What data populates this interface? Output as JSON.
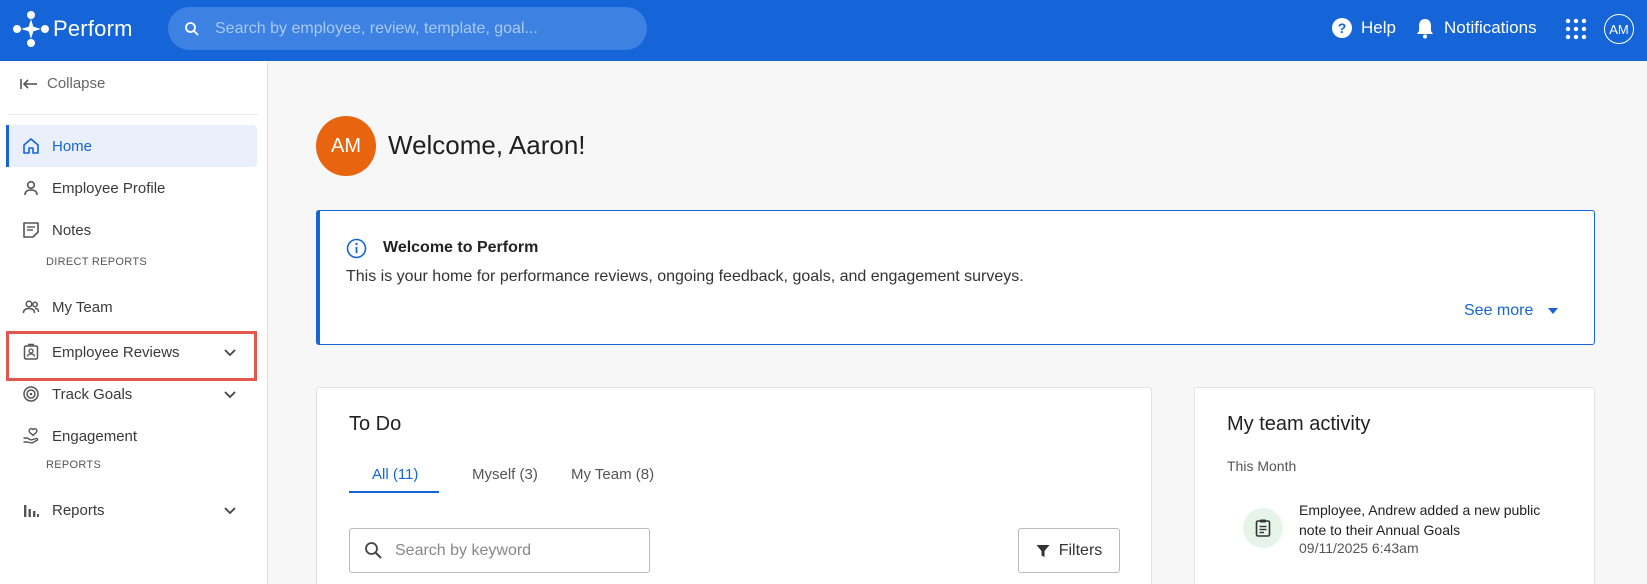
{
  "header": {
    "app_name": "Perform",
    "search_placeholder": "Search by employee, review, template, goal...",
    "help_label": "Help",
    "notifications_label": "Notifications",
    "user_initials": "AM",
    "brand_color": "#1565d8"
  },
  "sidebar": {
    "collapse_label": "Collapse",
    "items": [
      {
        "label": "Home",
        "icon": "home-icon",
        "active": true
      },
      {
        "label": "Employee Profile",
        "icon": "person-icon"
      },
      {
        "label": "Notes",
        "icon": "note-icon"
      },
      {
        "label": "My Team",
        "icon": "team-icon"
      },
      {
        "label": "Employee Reviews",
        "icon": "review-badge-icon",
        "expandable": true,
        "highlighted": true
      },
      {
        "label": "Track Goals",
        "icon": "target-icon",
        "expandable": true
      },
      {
        "label": "Engagement",
        "icon": "hand-heart-icon"
      },
      {
        "label": "Reports",
        "icon": "bar-chart-icon",
        "expandable": true
      }
    ],
    "sections": {
      "direct_reports": "DIRECT REPORTS",
      "reports": "REPORTS"
    }
  },
  "main": {
    "welcome": {
      "initials": "AM",
      "title": "Welcome, Aaron!",
      "avatar_color": "#e8640f"
    },
    "info": {
      "heading": "Welcome to Perform",
      "body": "This is your home for performance reviews, ongoing feedback, goals, and engagement surveys.",
      "see_more": "See more"
    },
    "todo": {
      "title": "To Do",
      "tabs": [
        "All (11)",
        "Myself (3)",
        "My Team (8)"
      ],
      "active_tab": "All (11)",
      "search_placeholder": "Search by keyword",
      "filters_label": "Filters"
    },
    "activity": {
      "title": "My team activity",
      "period": "This Month",
      "item_text": "Employee, Andrew added a new public note to their Annual Goals",
      "item_time": "09/11/2025 6:43am"
    }
  }
}
